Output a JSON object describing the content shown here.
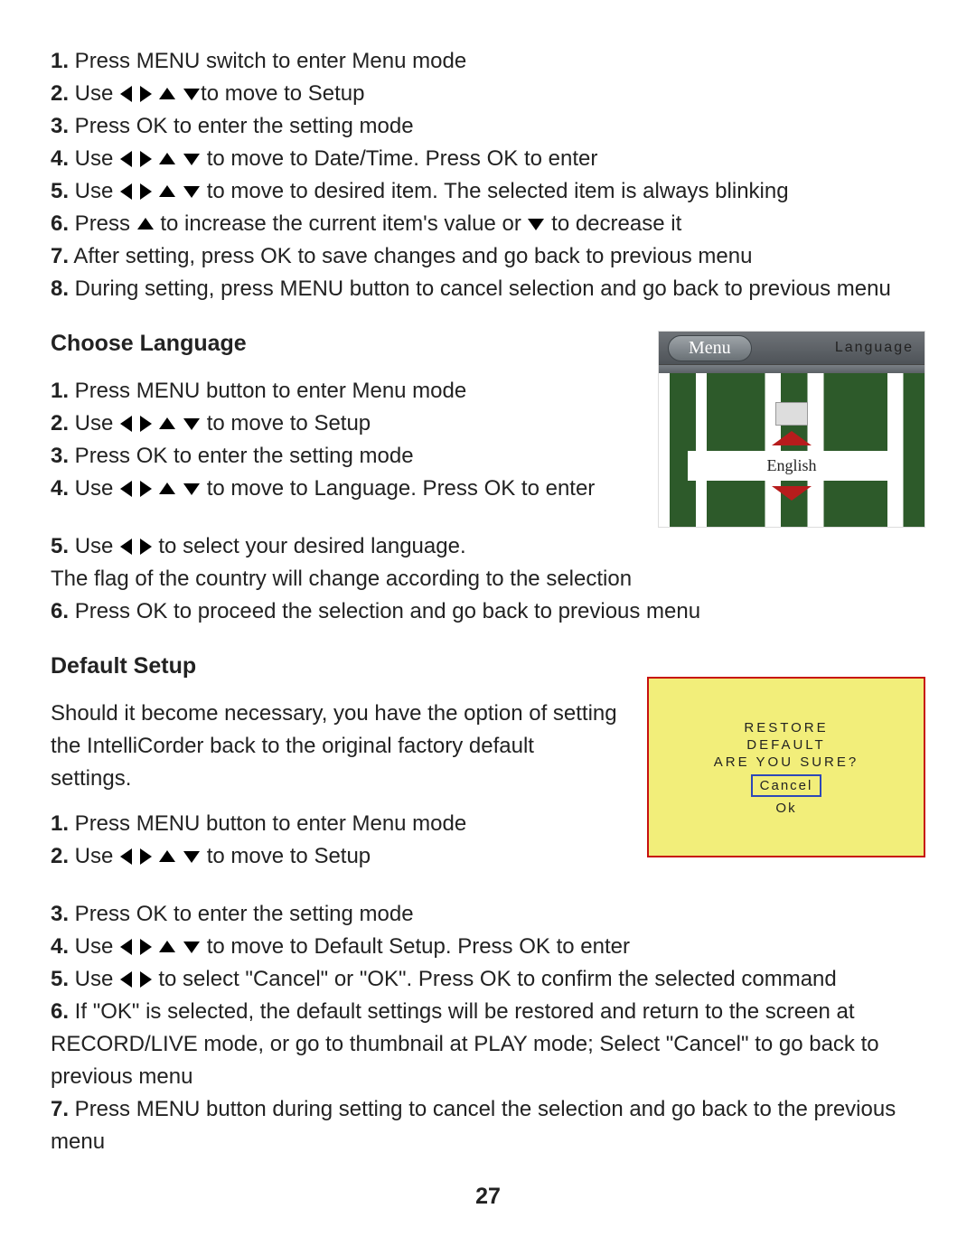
{
  "steps_a": [
    {
      "n": "1.",
      "before": "Press MENU switch to enter Menu mode",
      "arrows": "",
      "after": ""
    },
    {
      "n": "2.",
      "before": "Use",
      "arrows": "lrud",
      "after": "to move to Setup"
    },
    {
      "n": "3.",
      "before": "Press OK to enter the setting mode",
      "arrows": "",
      "after": ""
    },
    {
      "n": "4.",
      "before": "Use",
      "arrows": "lrud",
      "after": " to move to Date/Time.  Press OK to enter"
    },
    {
      "n": "5.",
      "before": "Use",
      "arrows": "lrud",
      "after": " to move to desired item. The selected item is always blinking"
    }
  ],
  "step_a6": {
    "n": "6.",
    "p1": "Press ",
    "p2": " to increase the current item's value or ",
    "p3": " to decrease it"
  },
  "step_a7": {
    "n": "7.",
    "t": "After setting, press OK to save changes and go back to previous menu"
  },
  "step_a8": {
    "n": "8.",
    "t": "During setting, press MENU button to cancel selection and go back to previous menu"
  },
  "heading_lang": "Choose Language",
  "steps_b": [
    {
      "n": "1.",
      "before": "Press MENU button to enter Menu mode",
      "arrows": "",
      "after": ""
    },
    {
      "n": "2.",
      "before": "Use",
      "arrows": "lrud",
      "after": " to move to Setup"
    },
    {
      "n": "3.",
      "before": "Press OK to enter the setting mode",
      "arrows": "",
      "after": ""
    },
    {
      "n": "4.",
      "before": "Use",
      "arrows": "lrud",
      "after": " to move to Language.  Press OK to enter"
    }
  ],
  "step_b5": {
    "n": "5.",
    "p1": "Use",
    "p2": " to select your desired language."
  },
  "step_b5b": "The flag of the country will change according to the selection",
  "step_b6": {
    "n": "6.",
    "t": "Press OK to proceed the selection and go back to previous menu"
  },
  "lang_illus": {
    "menu": "Menu",
    "label": "Language",
    "value": "English"
  },
  "heading_default": "Default Setup",
  "default_intro": "Should it become necessary, you have the option of setting the IntelliCorder back to the original factory default settings.",
  "steps_c": [
    {
      "n": "1.",
      "before": "Press MENU button to enter Menu mode",
      "arrows": "",
      "after": ""
    },
    {
      "n": "2.",
      "before": "Use",
      "arrows": "lrud",
      "after": " to move to Setup"
    },
    {
      "n": "3.",
      "before": "Press OK to enter the setting mode",
      "arrows": "",
      "after": ""
    },
    {
      "n": "4.",
      "before": "Use",
      "arrows": "lrud",
      "after": " to move to Default Setup.  Press OK to enter"
    }
  ],
  "step_c5": {
    "n": "5.",
    "p1": "Use",
    "p2": " to select \"Cancel\" or \"OK\".  Press OK to confirm the selected command"
  },
  "step_c6": {
    "n": "6.",
    "t": "If \"OK\" is selected, the default settings will be restored and return to the screen at RECORD/LIVE mode, or go to thumbnail at PLAY mode; Select \"Cancel\" to go back to previous menu"
  },
  "step_c7": {
    "n": "7.",
    "t": "Press MENU button during setting to cancel the selection and go back to the previous menu"
  },
  "default_illus": {
    "l1": "RESTORE",
    "l2": "DEFAULT",
    "l3": "ARE YOU SURE?",
    "cancel": "Cancel",
    "ok": "Ok"
  },
  "page_number": "27"
}
